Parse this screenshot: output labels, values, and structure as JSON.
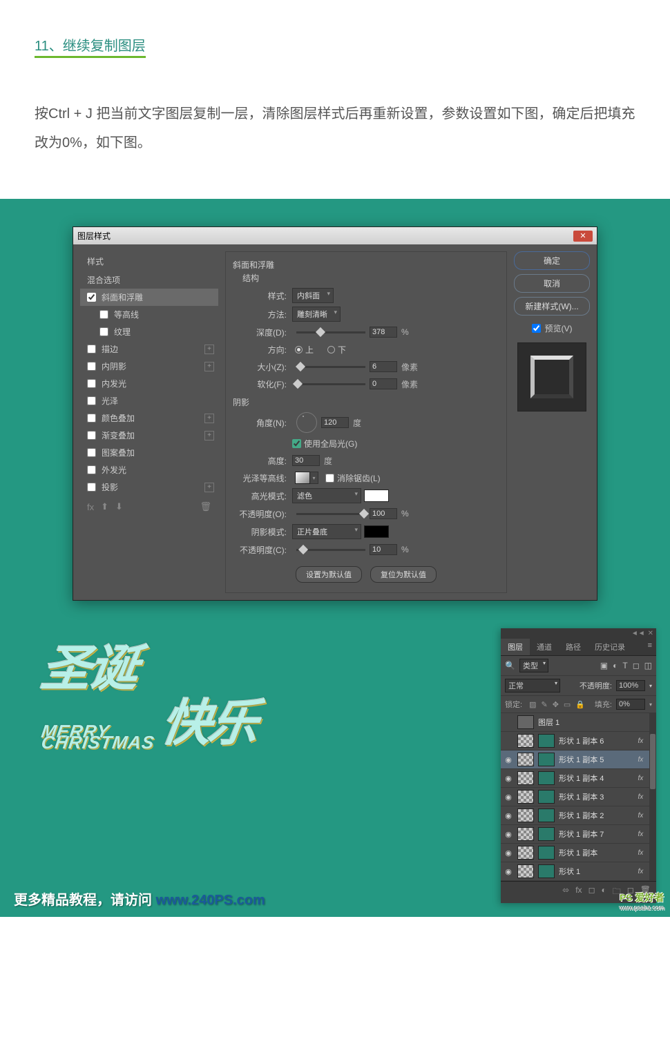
{
  "article": {
    "step_title": "11、继续复制图层",
    "desc": "按Ctrl + J 把当前文字图层复制一层，清除图层样式后再重新设置，参数设置如下图，确定后把填充改为0%，如下图。"
  },
  "dialog": {
    "title": "图层样式",
    "close": "✕",
    "styles_header": "样式",
    "blend_options": "混合选项",
    "effects": [
      {
        "label": "斜面和浮雕",
        "checked": true,
        "selected": true
      },
      {
        "label": "等高线",
        "checked": false,
        "indent": true
      },
      {
        "label": "纹理",
        "checked": false,
        "indent": true
      },
      {
        "label": "描边",
        "checked": false,
        "plus": true
      },
      {
        "label": "内阴影",
        "checked": false,
        "plus": true
      },
      {
        "label": "内发光",
        "checked": false
      },
      {
        "label": "光泽",
        "checked": false
      },
      {
        "label": "颜色叠加",
        "checked": false,
        "plus": true
      },
      {
        "label": "渐变叠加",
        "checked": false,
        "plus": true
      },
      {
        "label": "图案叠加",
        "checked": false
      },
      {
        "label": "外发光",
        "checked": false
      },
      {
        "label": "投影",
        "checked": false,
        "plus": true
      }
    ],
    "footer_fx": "fx",
    "bevel": {
      "section": "斜面和浮雕",
      "structure": "结构",
      "style_lbl": "样式:",
      "style_val": "内斜面",
      "technique_lbl": "方法:",
      "technique_val": "雕刻清晰",
      "depth_lbl": "深度(D):",
      "depth_val": "378",
      "depth_unit": "%",
      "direction_lbl": "方向:",
      "up": "上",
      "down": "下",
      "size_lbl": "大小(Z):",
      "size_val": "6",
      "size_unit": "像素",
      "soften_lbl": "软化(F):",
      "soften_val": "0",
      "soften_unit": "像素"
    },
    "shading": {
      "section": "阴影",
      "angle_lbl": "角度(N):",
      "angle_val": "120",
      "angle_unit": "度",
      "global_lbl": "使用全局光(G)",
      "altitude_lbl": "高度:",
      "altitude_val": "30",
      "altitude_unit": "度",
      "gloss_lbl": "光泽等高线:",
      "antialias_lbl": "消除锯齿(L)",
      "highlight_lbl": "高光模式:",
      "highlight_val": "滤色",
      "h_opacity_lbl": "不透明度(O):",
      "h_opacity_val": "100",
      "h_opacity_unit": "%",
      "shadow_lbl": "阴影模式:",
      "shadow_val": "正片叠底",
      "s_opacity_lbl": "不透明度(C):",
      "s_opacity_val": "10",
      "s_opacity_unit": "%"
    },
    "defaults_btn": "设置为默认值",
    "reset_btn": "复位为默认值",
    "ok": "确定",
    "cancel": "取消",
    "new_style": "新建样式(W)...",
    "preview": "预览(V)"
  },
  "layers_panel": {
    "tabs": [
      "图层",
      "通道",
      "路径",
      "历史记录"
    ],
    "filter": "类型",
    "blend_mode": "正常",
    "opacity_lbl": "不透明度:",
    "opacity_val": "100%",
    "lock_lbl": "锁定:",
    "fill_lbl": "填充:",
    "fill_val": "0%",
    "layers": [
      {
        "name": "图层 1",
        "eye": false,
        "thumb": "plain",
        "fx": false
      },
      {
        "name": "形状 1 副本 6",
        "eye": false,
        "thumb": "img",
        "fx": true
      },
      {
        "name": "形状 1 副本 5",
        "eye": true,
        "thumb": "img",
        "fx": true,
        "selected": true
      },
      {
        "name": "形状 1 副本 4",
        "eye": true,
        "thumb": "img",
        "fx": true
      },
      {
        "name": "形状 1 副本 3",
        "eye": true,
        "thumb": "img",
        "fx": true
      },
      {
        "name": "形状 1 副本 2",
        "eye": true,
        "thumb": "img",
        "fx": true
      },
      {
        "name": "形状 1 副本 7",
        "eye": true,
        "thumb": "img",
        "fx": true
      },
      {
        "name": "形状 1 副本",
        "eye": true,
        "thumb": "img",
        "fx": true
      },
      {
        "name": "形状 1",
        "eye": true,
        "thumb": "img",
        "fx": true
      }
    ]
  },
  "art": {
    "cn1": "圣诞",
    "cn2": "快乐",
    "en1": "MERRY",
    "en2": "CHRISTMAS"
  },
  "footer": {
    "text": "更多精品教程，请访问 ",
    "link": "www.240PS.com"
  },
  "watermark": {
    "main": "PS 爱好者",
    "sub": "www.psahz.com"
  }
}
